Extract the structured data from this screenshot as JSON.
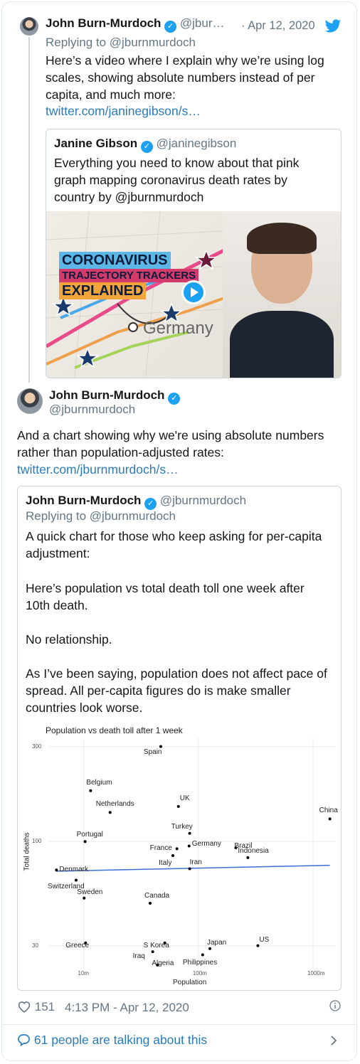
{
  "parent_tweet": {
    "name": "John Burn-Murdoch",
    "handle": "@jbur…",
    "date": "· Apr 12, 2020",
    "replying_to": "Replying to @jburnmurdoch",
    "text": "Here’s a video where I explain why we’re using log scales, showing absolute numbers instead of per capita, and much more:",
    "link": "twitter.com/janinegibson/s…",
    "quote": {
      "name": "Janine Gibson",
      "handle": "@janinegibson",
      "text": "Everything you need to know about that pink graph mapping coronavirus death rates by country  by @jburnmurdoch",
      "video": {
        "line1": "CORONAVIRUS",
        "line2": "TRAJECTORY TRACKERS",
        "line3": "EXPLAINED",
        "map_label": "Germany"
      }
    }
  },
  "main_tweet": {
    "name": "John Burn-Murdoch",
    "handle": "@jburnmurdoch",
    "text": "And a chart showing why we're using absolute numbers rather than population-adjusted rates:",
    "link": "twitter.com/jburnmurdoch/s…",
    "quote": {
      "name": "John Burn-Murdoch",
      "handle": "@jburnmurdoch",
      "replying_to": "Replying to @jburnmurdoch",
      "p1": "A quick chart for those who keep asking for per-capita adjustment:",
      "p2": "Here’s population vs total death toll one week after 10th death.",
      "p3": "No relationship.",
      "p4": "As I’ve been saying, population does not affect pace of spread. All per-capita figures do is make smaller countries look worse."
    },
    "likes": "151",
    "timestamp": "4:13 PM - Apr 12, 2020",
    "talking": "61 people are talking about this"
  },
  "chart_data": {
    "type": "scatter",
    "title": "Population vs death toll after 1 week",
    "xlabel": "Population",
    "ylabel": "Total deaths",
    "x_scale": "log",
    "y_scale": "log",
    "x_ticks": [
      "10m",
      "100m",
      "1000m"
    ],
    "y_ticks": [
      "300",
      "100",
      "30"
    ],
    "xlim_m": [
      5,
      1600
    ],
    "ylim": [
      23,
      330
    ],
    "grid": true,
    "points": [
      {
        "label": "Spain",
        "x": 47,
        "y": 300
      },
      {
        "label": "Belgium",
        "x": 11.5,
        "y": 180
      },
      {
        "label": "Netherlands",
        "x": 17,
        "y": 140
      },
      {
        "label": "UK",
        "x": 67,
        "y": 150
      },
      {
        "label": "China",
        "x": 1400,
        "y": 130
      },
      {
        "label": "Portugal",
        "x": 10.3,
        "y": 100
      },
      {
        "label": "Turkey",
        "x": 84,
        "y": 110
      },
      {
        "label": "Germany",
        "x": 83,
        "y": 95
      },
      {
        "label": "Brazil",
        "x": 212,
        "y": 93
      },
      {
        "label": "France",
        "x": 65,
        "y": 92
      },
      {
        "label": "Indonesia",
        "x": 270,
        "y": 83
      },
      {
        "label": "Italy",
        "x": 60,
        "y": 85
      },
      {
        "label": "Iran",
        "x": 84,
        "y": 73
      },
      {
        "label": "Denmark",
        "x": 5.8,
        "y": 72
      },
      {
        "label": "Switzerland",
        "x": 8.6,
        "y": 64
      },
      {
        "label": "Sweden",
        "x": 10.1,
        "y": 52
      },
      {
        "label": "Canada",
        "x": 38,
        "y": 49
      },
      {
        "label": "Greece",
        "x": 10.4,
        "y": 31
      },
      {
        "label": "S Korea",
        "x": 51,
        "y": 31
      },
      {
        "label": "US",
        "x": 330,
        "y": 30
      },
      {
        "label": "Japan",
        "x": 126,
        "y": 29
      },
      {
        "label": "Iraq",
        "x": 40,
        "y": 28
      },
      {
        "label": "Philippines",
        "x": 109,
        "y": 27
      },
      {
        "label": "Algeria",
        "x": 44,
        "y": 24
      }
    ],
    "trend": [
      {
        "x": 5.8,
        "y": 71
      },
      {
        "x": 1400,
        "y": 76
      }
    ]
  }
}
